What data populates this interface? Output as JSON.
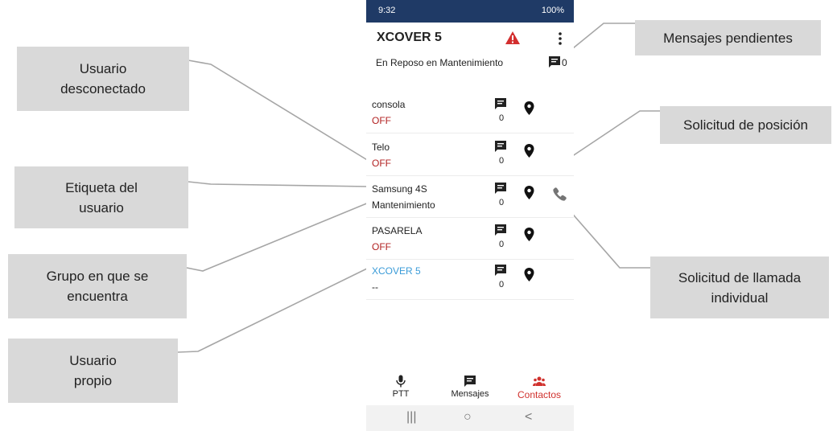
{
  "callouts": {
    "usuario_desconectado": "Usuario\ndesconectado",
    "etiqueta_usuario": "Etiqueta del\nusuario",
    "grupo": "Grupo en que se\nencuentra",
    "usuario_propio": "Usuario\npropio",
    "mensajes_pendientes": "Mensajes pendientes",
    "solicitud_posicion": "Solicitud de posición",
    "solicitud_llamada": "Solicitud de llamada\nindividual"
  },
  "statusbar": {
    "time": "9:32",
    "right_text": "100%"
  },
  "app": {
    "title": "XCOVER 5",
    "state_text": "En Reposo en Mantenimiento",
    "state_msg_count": "0"
  },
  "contacts": [
    {
      "name": "consola",
      "status": "OFF",
      "count": "0"
    },
    {
      "name": "Telo",
      "status": "OFF",
      "count": "0"
    },
    {
      "name": "Samsung 4S",
      "status": "Mantenimiento",
      "count": "0"
    },
    {
      "name": "PASARELA",
      "status": "OFF",
      "count": "0"
    },
    {
      "name": "XCOVER 5",
      "status": "--",
      "count": "0"
    }
  ],
  "bottom_nav": {
    "ptt": "PTT",
    "mensajes": "Mensajes",
    "contactos": "Contactos"
  },
  "system_nav": {
    "recent": "|||",
    "home": "○",
    "back": "<"
  },
  "colors": {
    "statusbar": "#1f3a66",
    "off": "#b22222",
    "self": "#3a9bd8",
    "active_nav": "#d0312d",
    "callout_bg": "#d9d9d9"
  },
  "icons": [
    "warning-icon",
    "more-vert-icon",
    "message-icon",
    "location-pin-icon",
    "phone-icon",
    "mic-icon",
    "contacts-icon"
  ]
}
